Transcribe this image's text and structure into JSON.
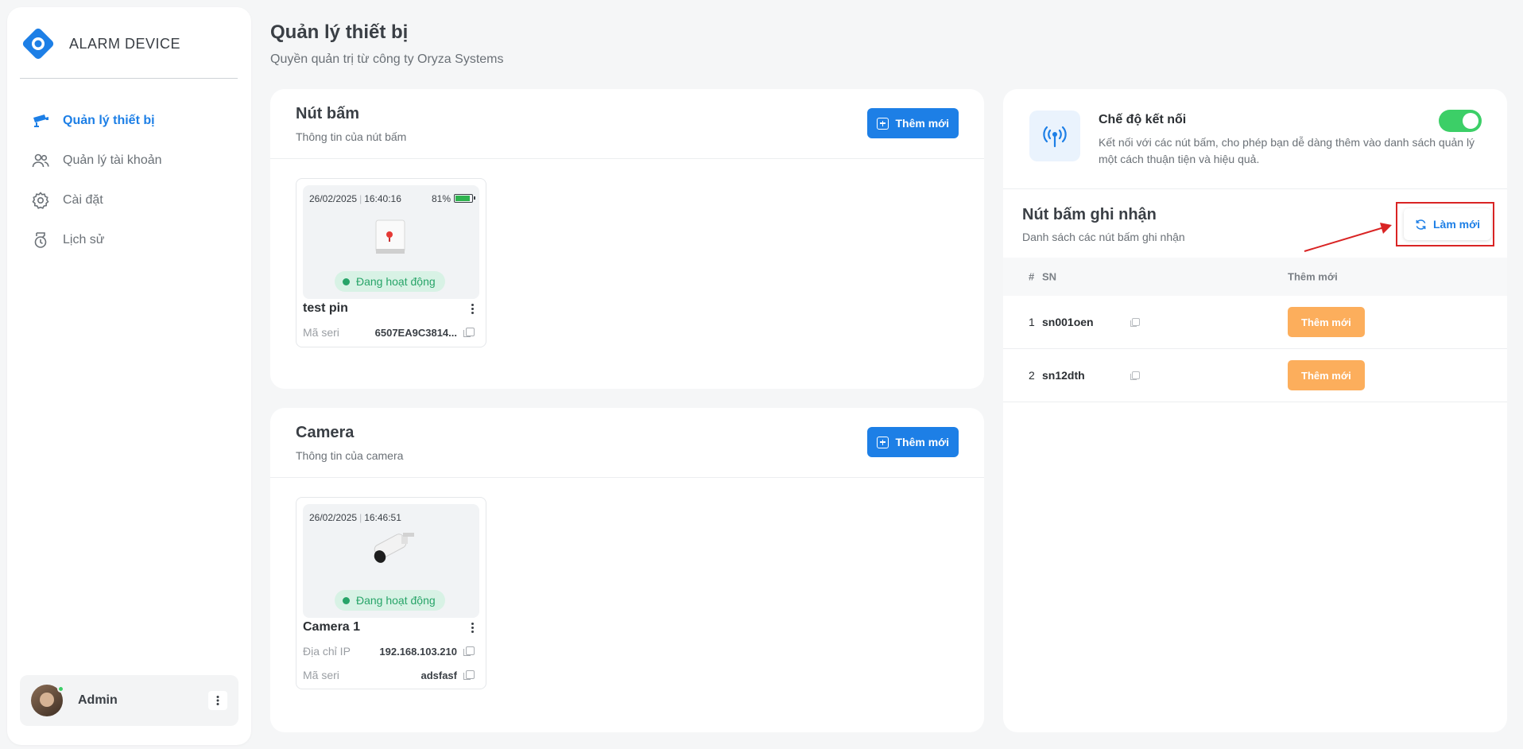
{
  "app": {
    "logo_text": "ALARM DEVICE"
  },
  "sidebar": {
    "items": [
      {
        "label": "Quản lý thiết bị",
        "icon": "cctv-camera-icon",
        "active": true
      },
      {
        "label": "Quản lý tài khoản",
        "icon": "users-icon",
        "active": false
      },
      {
        "label": "Cài đặt",
        "icon": "gear-icon",
        "active": false
      },
      {
        "label": "Lịch sử",
        "icon": "history-icon",
        "active": false
      }
    ],
    "user": {
      "name": "Admin",
      "status": "online"
    }
  },
  "page": {
    "title": "Quản lý thiết bị",
    "subtitle": "Quyền quản trị từ công ty Oryza Systems"
  },
  "buttons_card": {
    "title": "Nút bấm",
    "subtitle": "Thông tin của nút bấm",
    "add_label": "Thêm mới",
    "device": {
      "date": "26/02/2025",
      "time": "16:40:16",
      "battery": "81%",
      "battery_level": 0.81,
      "status": "Đang hoạt động",
      "name": "test pin",
      "serial_label": "Mã seri",
      "serial": "6507EA9C3814..."
    }
  },
  "camera_card": {
    "title": "Camera",
    "subtitle": "Thông tin của camera",
    "add_label": "Thêm mới",
    "device": {
      "date": "26/02/2025",
      "time": "16:46:51",
      "status": "Đang hoạt động",
      "name": "Camera 1",
      "ip_label": "Địa chỉ IP",
      "ip": "192.168.103.210",
      "serial_label": "Mã seri",
      "serial": "adsfasf"
    }
  },
  "connection": {
    "title": "Chế độ kết nối",
    "description": "Kết nối với các nút bấm, cho phép bạn dễ dàng thêm vào danh sách quản lý một cách thuận tiện và hiệu quả.",
    "enabled": true
  },
  "recorded": {
    "title": "Nút bấm ghi nhận",
    "subtitle": "Danh sách các nút bấm ghi nhận",
    "refresh_label": "Làm mới",
    "columns": {
      "num": "#",
      "sn": "SN",
      "action": "Thêm mới"
    },
    "rows": [
      {
        "num": "1",
        "sn": "sn001oen",
        "action": "Thêm mới"
      },
      {
        "num": "2",
        "sn": "sn12dth",
        "action": "Thêm mới"
      }
    ]
  },
  "colors": {
    "primary": "#1d7fe6",
    "success": "#3ccf67",
    "warning": "#fcae5c",
    "highlight": "#d92424"
  }
}
